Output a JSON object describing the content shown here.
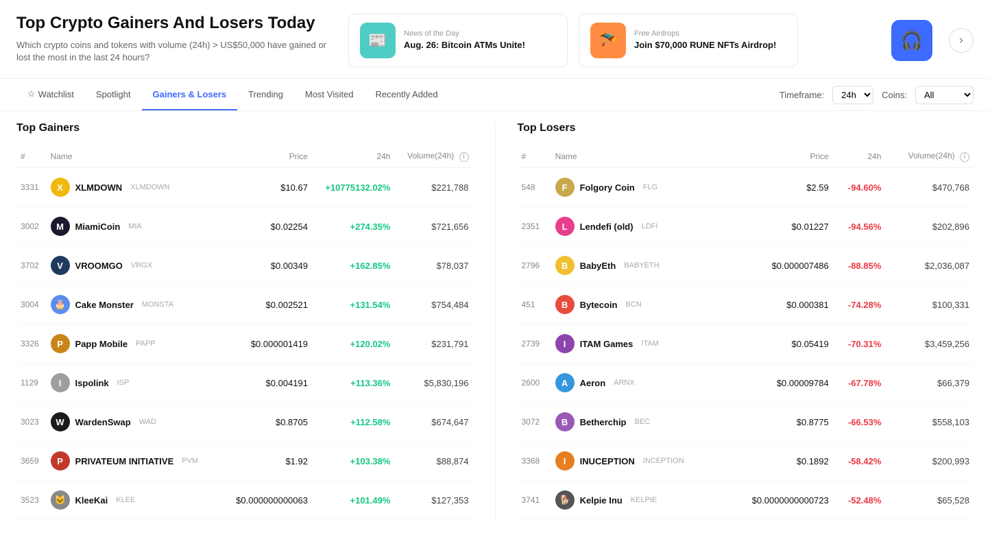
{
  "page": {
    "title": "Top Crypto Gainers And Losers Today",
    "subtitle": "Which crypto coins and tokens with volume (24h) > US$50,000 have gained or lost the most in the last 24 hours?"
  },
  "news": [
    {
      "id": "news1",
      "label": "News of the Day",
      "title": "Aug. 26: Bitcoin ATMs Unite!",
      "icon": "📰",
      "icon_bg": "teal"
    },
    {
      "id": "news2",
      "label": "Free Airdrops",
      "title": "Join $70,000 RUNE NFTs Airdrop!",
      "icon": "🪂",
      "icon_bg": "orange"
    }
  ],
  "promo_icon": "🎧",
  "nav": {
    "items": [
      {
        "id": "watchlist",
        "label": "Watchlist",
        "active": false,
        "watchlist": true
      },
      {
        "id": "spotlight",
        "label": "Spotlight",
        "active": false
      },
      {
        "id": "gainers-losers",
        "label": "Gainers & Losers",
        "active": true
      },
      {
        "id": "trending",
        "label": "Trending",
        "active": false
      },
      {
        "id": "most-visited",
        "label": "Most Visited",
        "active": false
      },
      {
        "id": "recently-added",
        "label": "Recently Added",
        "active": false
      }
    ],
    "timeframe_label": "Timeframe:",
    "timeframe_value": "24h",
    "coins_label": "Coins:",
    "coins_value": "All"
  },
  "gainers": {
    "title": "Top Gainers",
    "columns": [
      "#",
      "Name",
      "Price",
      "24h",
      "Volume(24h)"
    ],
    "rows": [
      {
        "rank": "3331",
        "name": "XLMDOWN",
        "symbol": "XLMDOWN",
        "price": "$10.67",
        "change": "+10775132.02%",
        "volume": "$221,788",
        "color": "#f0b90b",
        "logo_text": "X"
      },
      {
        "rank": "3002",
        "name": "MiamiCoin",
        "symbol": "MIA",
        "price": "$0.02254",
        "change": "+274.35%",
        "volume": "$721,656",
        "color": "#1a1a2e",
        "logo_text": "M"
      },
      {
        "rank": "3702",
        "name": "VROOMGO",
        "symbol": "VRGX",
        "price": "$0.00349",
        "change": "+162.85%",
        "volume": "$78,037",
        "color": "#1e3a5f",
        "logo_text": "V"
      },
      {
        "rank": "3004",
        "name": "Cake Monster",
        "symbol": "MONSTA",
        "price": "$0.002521",
        "change": "+131.54%",
        "volume": "$754,484",
        "color": "#5b8dee",
        "logo_text": "🎂"
      },
      {
        "rank": "3326",
        "name": "Papp Mobile",
        "symbol": "PAPP",
        "price": "$0.000001419",
        "change": "+120.02%",
        "volume": "$231,791",
        "color": "#c9851a",
        "logo_text": "P"
      },
      {
        "rank": "1129",
        "name": "Ispolink",
        "symbol": "ISP",
        "price": "$0.004191",
        "change": "+113.36%",
        "volume": "$5,830,196",
        "color": "#9e9e9e",
        "logo_text": "I"
      },
      {
        "rank": "3023",
        "name": "WardenSwap",
        "symbol": "WAD",
        "price": "$0.8705",
        "change": "+112.58%",
        "volume": "$674,647",
        "color": "#1a1a1a",
        "logo_text": "W"
      },
      {
        "rank": "3659",
        "name": "PRIVATEUM INITIATIVE",
        "symbol": "PVM",
        "price": "$1.92",
        "change": "+103.38%",
        "volume": "$88,874",
        "color": "#c0392b",
        "logo_text": "P"
      },
      {
        "rank": "3523",
        "name": "KleeKai",
        "symbol": "KLEE",
        "price": "$0.000000000063",
        "change": "+101.49%",
        "volume": "$127,353",
        "color": "#888",
        "logo_text": "🐱"
      }
    ]
  },
  "losers": {
    "title": "Top Losers",
    "columns": [
      "#",
      "Name",
      "Price",
      "24h",
      "Volume(24h)"
    ],
    "rows": [
      {
        "rank": "548",
        "name": "Folgory Coin",
        "symbol": "FLG",
        "price": "$2.59",
        "change": "-94.60%",
        "volume": "$470,768",
        "color": "#c8a84b",
        "logo_text": "F"
      },
      {
        "rank": "2351",
        "name": "Lendefi (old)",
        "symbol": "LDFI",
        "price": "$0.01227",
        "change": "-94.56%",
        "volume": "$202,896",
        "color": "#e83e8c",
        "logo_text": "L"
      },
      {
        "rank": "2796",
        "name": "BabyEth",
        "symbol": "BABYETH",
        "price": "$0.000007486",
        "change": "-88.85%",
        "volume": "$2,036,087",
        "color": "#f0c030",
        "logo_text": "B"
      },
      {
        "rank": "451",
        "name": "Bytecoin",
        "symbol": "BCN",
        "price": "$0.000381",
        "change": "-74.28%",
        "volume": "$100,331",
        "color": "#e74c3c",
        "logo_text": "B"
      },
      {
        "rank": "2739",
        "name": "ITAM Games",
        "symbol": "ITAM",
        "price": "$0.05419",
        "change": "-70.31%",
        "volume": "$3,459,256",
        "color": "#8e44ad",
        "logo_text": "I"
      },
      {
        "rank": "2600",
        "name": "Aeron",
        "symbol": "ARNX",
        "price": "$0.00009784",
        "change": "-67.78%",
        "volume": "$66,379",
        "color": "#3498db",
        "logo_text": "A"
      },
      {
        "rank": "3072",
        "name": "Betherchip",
        "symbol": "BEC",
        "price": "$0.8775",
        "change": "-66.53%",
        "volume": "$558,103",
        "color": "#9b59b6",
        "logo_text": "B"
      },
      {
        "rank": "3368",
        "name": "INUCEPTION",
        "symbol": "INCEPTION",
        "price": "$0.1892",
        "change": "-58.42%",
        "volume": "$200,993",
        "color": "#e67e22",
        "logo_text": "I"
      },
      {
        "rank": "3741",
        "name": "Kelpie Inu",
        "symbol": "KELPIE",
        "price": "$0.0000000000723",
        "change": "-52.48%",
        "volume": "$65,528",
        "color": "#555",
        "logo_text": "🐕"
      }
    ]
  }
}
